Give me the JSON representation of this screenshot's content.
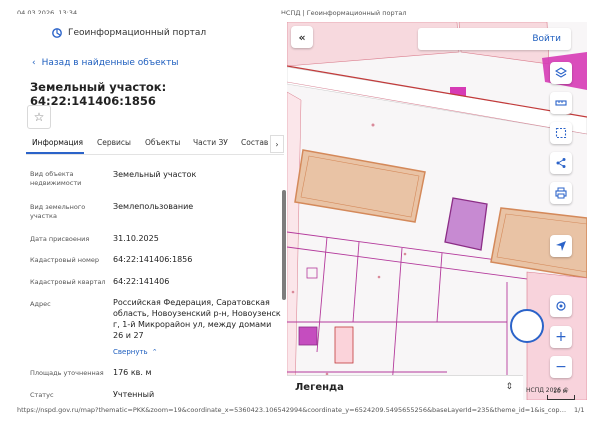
{
  "print_header": {
    "datetime": "04.03.2026, 13:34",
    "page_title": "НСПД | Геоинформационный портал"
  },
  "print_footer": {
    "url": "https://nspd.gov.ru/map?thematic=PKK&zoom=19&coordinate_x=5360423.106542994&coordinate_y=6524209.5495655256&baseLayerId=235&theme_id=1&is_copy_url=true&act...",
    "page": "1/1"
  },
  "panel": {
    "brand": "Геоинформационный портал",
    "back_link": "Назад в найденные объекты",
    "title": "Земельный участок: 64:22:141406:1856",
    "tabs": [
      "Информация",
      "Сервисы",
      "Объекты",
      "Части ЗУ",
      "Состав"
    ],
    "attributes": [
      {
        "label": "Вид объекта недвижимости",
        "value": "Земельный участок"
      },
      {
        "label": "Вид земельного участка",
        "value": "Землепользование"
      },
      {
        "label": "Дата присвоения",
        "value": "31.10.2025"
      },
      {
        "label": "Кадастровый номер",
        "value": "64:22:141406:1856"
      },
      {
        "label": "Кадастровый квартал",
        "value": "64:22:141406"
      },
      {
        "label": "Адрес",
        "value": "Российская Федерация, Саратовская область, Новоузенский р-н, Новоузенск г, 1-й Микрорайон ул, между домами 26 и 27"
      },
      {
        "label": "Площадь уточненная",
        "value": "176 кв. м"
      },
      {
        "label": "Статус",
        "value": "Учтенный"
      }
    ],
    "collapse_label": "Свернуть"
  },
  "map": {
    "login_label": "Войти",
    "legend_label": "Легенда",
    "attribution": "НСПД 2026 ©",
    "scale_label": "10 м",
    "controls": [
      "layers-icon",
      "ruler-icon",
      "select-area-icon",
      "share-icon",
      "print-icon",
      "locate-icon",
      "navigation-icon",
      "zoom-in-icon",
      "zoom-out-icon"
    ]
  },
  "colors": {
    "accent": "#2b63c9",
    "parcel_fill": "#e9c3a5",
    "parcel_border": "#d4895a",
    "boundary": "#b43a9c",
    "selected_fill": "#c78ad2",
    "magenta": "#d63bb5"
  }
}
